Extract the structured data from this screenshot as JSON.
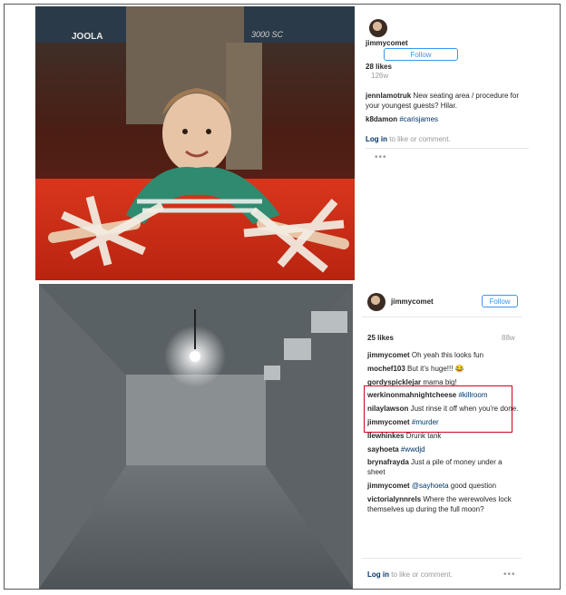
{
  "post1": {
    "username": "jimmycomet",
    "follow_label": "Follow",
    "likes": "28 likes",
    "age": "126w",
    "comments": [
      {
        "user": "jennlamotruk",
        "text": "New seating area / procedure for your youngest guests? Hilar."
      },
      {
        "user": "k8damon",
        "tag": "#carisjames"
      }
    ],
    "login_link": "Log in",
    "login_rest": "to like or comment.",
    "more_icon": "more-icon",
    "photo_text": {
      "table_brand": "JOOLA",
      "table_model": "3000 SC"
    }
  },
  "post2": {
    "username": "jimmycomet",
    "follow_label": "Follow",
    "likes": "25 likes",
    "age": "88w",
    "comments": [
      {
        "user": "jimmycomet",
        "text": "Oh yeah this looks fun"
      },
      {
        "user": "mochef103",
        "text": "But it's huge!!! 😂"
      },
      {
        "user": "gordyspicklejar",
        "text": "mama big!"
      },
      {
        "user": "werkinonmahnightcheese",
        "tag": "#killroom"
      },
      {
        "user": "nilaylawson",
        "text": "Just rinse it off when you're done."
      },
      {
        "user": "jimmycomet",
        "tag": "#murder"
      },
      {
        "user": "llewhinkes",
        "text": "Drunk tank"
      },
      {
        "user": "sayhoeta",
        "tag": "#wwdjd"
      },
      {
        "user": "brynafrayda",
        "text": "Just a pile of money under a sheet"
      },
      {
        "user": "jimmycomet",
        "mention": "@sayhoeta",
        "text": "good question"
      },
      {
        "user": "victorialynnrels",
        "text": "Where the werewolves lock themselves up during the full moon?"
      }
    ],
    "login_link": "Log in",
    "login_rest": "to like or comment.",
    "more_icon": "more-icon"
  },
  "colors": {
    "accent": "#3897f0",
    "highlight": "#d0021b",
    "link": "#003569"
  }
}
